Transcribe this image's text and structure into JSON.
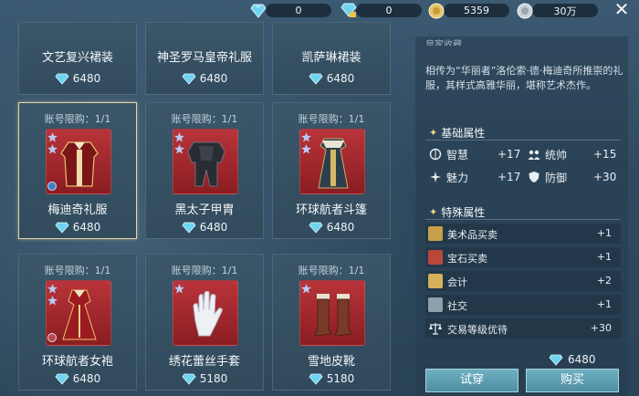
{
  "currency": {
    "gem_blue": "0",
    "gem_locked": "0",
    "gold": "5359",
    "silver": "30万"
  },
  "grid": {
    "row0": [
      {
        "name": "文艺复兴裙装",
        "price": "6480"
      },
      {
        "name": "神圣罗马皇帝礼服",
        "price": "6480"
      },
      {
        "name": "凯萨琳裙装",
        "price": "6480"
      }
    ],
    "row1": [
      {
        "limit": "账号限购：1/1",
        "name": "梅迪奇礼服",
        "price": "6480"
      },
      {
        "limit": "账号限购：1/1",
        "name": "黑太子甲胄",
        "price": "6480"
      },
      {
        "limit": "账号限购：1/1",
        "name": "环球航者斗篷",
        "price": "6480"
      }
    ],
    "row2": [
      {
        "limit": "账号限购：1/1",
        "name": "环球航者女袍",
        "price": "6480"
      },
      {
        "limit": "账号限购：1/1",
        "name": "绣花蕾丝手套",
        "price": "5180"
      },
      {
        "limit": "账号限购：1/1",
        "name": "雪地皮靴",
        "price": "5180"
      }
    ]
  },
  "detail": {
    "cut_title": "皇家收藏",
    "description": "相传为“华丽者”洛伦索·德·梅迪奇所推崇的礼服，其样式高雅华丽，堪称艺术杰作。",
    "basic_title": "基础属性",
    "basic": {
      "wisdom_label": "智慧",
      "wisdom_value": "+17",
      "command_label": "统帅",
      "command_value": "+15",
      "charm_label": "魅力",
      "charm_value": "+17",
      "defense_label": "防御",
      "defense_value": "+30"
    },
    "special_title": "特殊属性",
    "special": [
      {
        "label": "美术品买卖",
        "value": "+1"
      },
      {
        "label": "宝石买卖",
        "value": "+1"
      },
      {
        "label": "会计",
        "value": "+2"
      },
      {
        "label": "社交",
        "value": "+1"
      },
      {
        "label": "交易等级优待",
        "value": "+30"
      }
    ],
    "price": "6480",
    "try_on": "试穿",
    "buy": "购买"
  },
  "colors": {
    "accent_gold": "#f0d689",
    "button": "#5e9fb2",
    "card_bg": "#3a5668",
    "item_bg": "#b8343a"
  }
}
